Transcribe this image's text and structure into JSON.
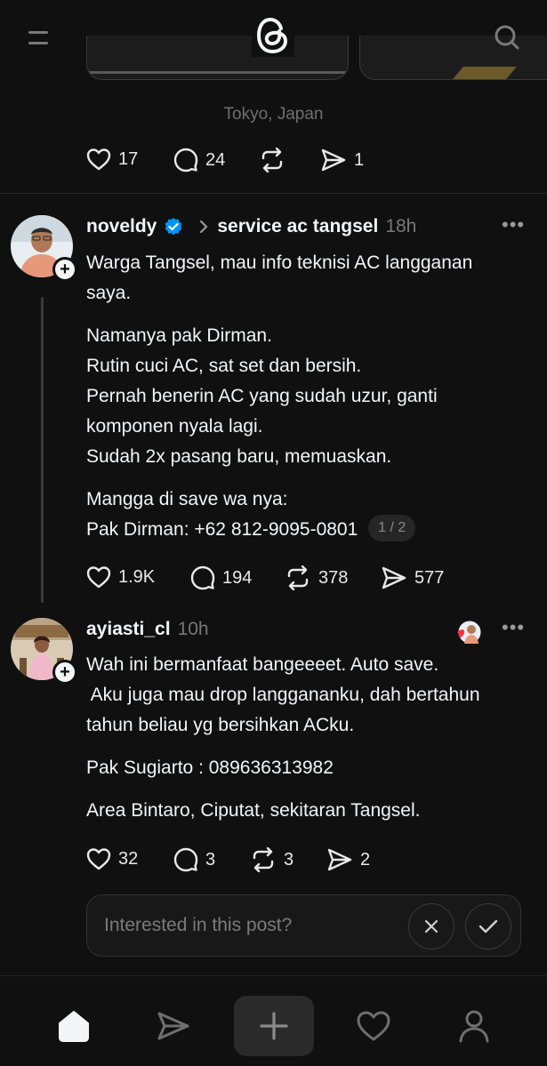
{
  "header": {
    "menu_icon": "hamburger-icon",
    "logo_icon": "threads-logo-icon",
    "search_icon": "search-icon"
  },
  "prev_post": {
    "location": "Tokyo, Japan",
    "likes": "17",
    "replies": "24",
    "reposts": "",
    "shares": "1"
  },
  "post": {
    "username": "noveldy",
    "verified": true,
    "community": "service ac tangsel",
    "time": "18h",
    "lines_p1": [
      "Warga Tangsel, mau info teknisi AC langganan",
      "saya."
    ],
    "lines_p2": [
      "Namanya pak Dirman.",
      "Rutin cuci AC, sat set dan bersih.",
      "Pernah benerin AC yang sudah uzur, ganti",
      "komponen nyala lagi.",
      "Sudah 2x pasang baru, memuaskan."
    ],
    "lines_p3_a": "Mangga di save wa nya:",
    "lines_p3_b": "Pak Dirman: +62 812-9095-0801",
    "page_indicator": "1 / 2",
    "likes": "1.9K",
    "replies": "194",
    "reposts": "378",
    "shares": "577"
  },
  "reply": {
    "username": "ayiasti_cl",
    "time": "10h",
    "lines_p1": [
      "Wah ini bermanfaat bangeeeet. Auto save.",
      " Aku juga mau drop langgananku, dah bertahun",
      "tahun beliau yg bersihkan ACku."
    ],
    "line_p2": "Pak Sugiarto : 089636313982",
    "line_p3": "Area Bintaro, Ciputat, sekitaran Tangsel.",
    "likes": "32",
    "replies": "3",
    "reposts": "3",
    "shares": "2"
  },
  "interest": {
    "placeholder": "Interested in this post?"
  },
  "nav": [
    "home-icon",
    "send-icon",
    "plus-icon",
    "heart-icon",
    "profile-icon"
  ],
  "colors": {
    "background": "#101010",
    "text": "#f3f5f7",
    "muted": "#777777",
    "verified": "#0095f6",
    "heart_red": "#ff3040"
  }
}
